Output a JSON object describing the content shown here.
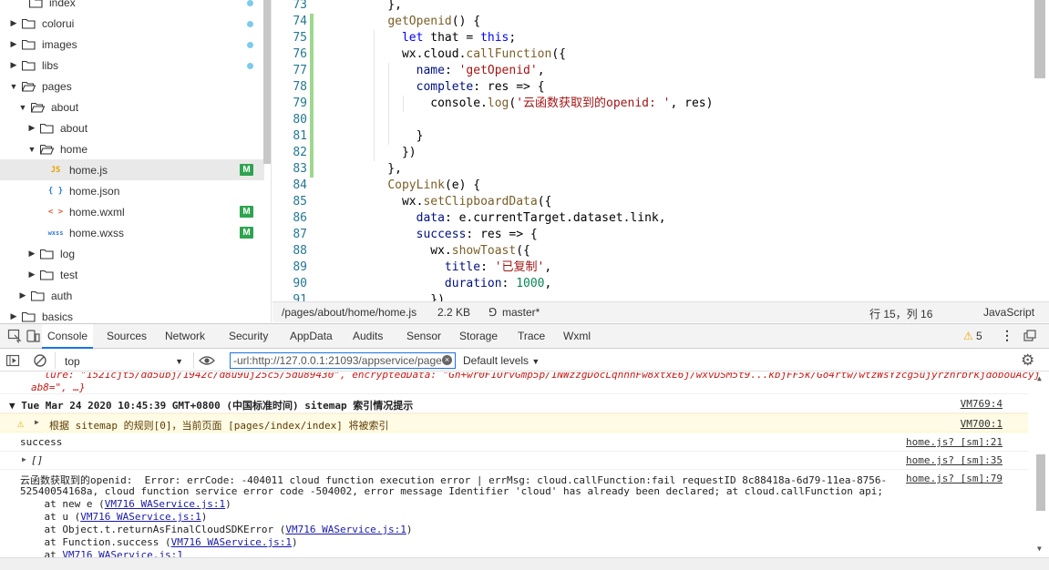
{
  "tree": {
    "items": [
      {
        "label": "index",
        "arrow": "",
        "icon": "folder",
        "dot": true
      },
      {
        "label": "colorui",
        "arrow": "▶",
        "icon": "folder",
        "dot": true
      },
      {
        "label": "images",
        "arrow": "▶",
        "icon": "folder",
        "dot": true
      },
      {
        "label": "libs",
        "arrow": "▶",
        "icon": "folder",
        "dot": true
      },
      {
        "label": "pages",
        "arrow": "▼",
        "icon": "folder-open"
      },
      {
        "label": "about",
        "arrow": "▼",
        "icon": "folder-open"
      },
      {
        "label": "about",
        "arrow": "▶",
        "icon": "folder"
      },
      {
        "label": "home",
        "arrow": "▼",
        "icon": "folder-open"
      },
      {
        "label": "home.js",
        "icon": "JS",
        "badge": "M",
        "selected": true
      },
      {
        "label": "home.json",
        "icon": "{ }"
      },
      {
        "label": "home.wxml",
        "icon": "< >",
        "badge": "M"
      },
      {
        "label": "home.wxss",
        "icon": "wxss",
        "badge": "M"
      },
      {
        "label": "log",
        "arrow": "▶",
        "icon": "folder"
      },
      {
        "label": "test",
        "arrow": "▶",
        "icon": "folder"
      },
      {
        "label": "auth",
        "arrow": "▶",
        "icon": "folder"
      },
      {
        "label": "basics",
        "arrow": "▶",
        "icon": "folder"
      }
    ]
  },
  "editor": {
    "lines": [
      {
        "n": "73",
        "code": "    },"
      },
      {
        "n": "74",
        "code": "    getOpenid() {"
      },
      {
        "n": "75",
        "code": "      let that = this;"
      },
      {
        "n": "76",
        "code": "      wx.cloud.callFunction({"
      },
      {
        "n": "77",
        "code": "        name: 'getOpenid',"
      },
      {
        "n": "78",
        "code": "        complete: res => {"
      },
      {
        "n": "79",
        "code": "          console.log('云函数获取到的openid: ', res)"
      },
      {
        "n": "80",
        "code": ""
      },
      {
        "n": "81",
        "code": "        }"
      },
      {
        "n": "82",
        "code": "      })"
      },
      {
        "n": "83",
        "code": "    },"
      },
      {
        "n": "84",
        "code": "    CopyLink(e) {"
      },
      {
        "n": "85",
        "code": "      wx.setClipboardData({"
      },
      {
        "n": "86",
        "code": "        data: e.currentTarget.dataset.link,"
      },
      {
        "n": "87",
        "code": "        success: res => {"
      },
      {
        "n": "88",
        "code": "          wx.showToast({"
      },
      {
        "n": "89",
        "code": "            title: '已复制',"
      },
      {
        "n": "90",
        "code": "            duration: 1000,"
      },
      {
        "n": "91",
        "code": "          })"
      }
    ]
  },
  "status": {
    "path": "/pages/about/home/home.js",
    "size": "2.2 KB",
    "branch": "master*",
    "position": "行 15，列 16",
    "language": "JavaScript"
  },
  "devtools": {
    "tabs": [
      "Console",
      "Sources",
      "Network",
      "Security",
      "AppData",
      "Audits",
      "Sensor",
      "Storage",
      "Trace",
      "Wxml"
    ],
    "active_tab": "Console",
    "warning_count": "5"
  },
  "console_toolbar": {
    "context": "top",
    "filter_value": "-url:http://127.0.0.1:21093/appservice/page",
    "levels": "Default levels"
  },
  "console": {
    "truncated_line": "    lure: \"1521cjt5/dd5ubj/1942c/d8u9uj25c5/5du89430\", encryptedData: \"Gn+wr0F1OrvGmp5p/1NWzzgDocLqhnhFw8xtxE6j/wxvDSM5t9...kbjFF5k/Go4rtw/wtzWsYzcg5ujyrznrbrkjdobouAcyj",
    "truncated_line2": "ab8=\", …}",
    "group_header": "▼ Tue Mar 24 2020 10:45:39 GMT+0800 (中国标准时间) sitemap 索引情况提示",
    "group_src": "VM769:4",
    "warning_text": "根据 sitemap 的规则[0]，当前页面 [pages/index/index] 将被索引",
    "warning_src": "VM700:1",
    "success_text": "success",
    "success_src": "home.js? [sm]:21",
    "array_text": "[]",
    "array_src": "home.js? [sm]:35",
    "error_line1": "云函数获取到的openid:  Error: errCode: -404011 cloud function execution error | errMsg: cloud.callFunction:fail requestID 8c88418a-6d79-11ea-8756-",
    "error_line2": "52540054168a, cloud function service error code -504002, error message Identifier 'cloud' has already been declared; at cloud.callFunction api;",
    "error_src": "home.js? [sm]:79",
    "stack": [
      {
        "prefix": "    at new e (",
        "link": "VM716 WAService.js:1",
        "suffix": ")"
      },
      {
        "prefix": "    at u (",
        "link": "VM716 WAService.js:1",
        "suffix": ")"
      },
      {
        "prefix": "    at Object.t.returnAsFinalCloudSDKError (",
        "link": "VM716 WAService.js:1",
        "suffix": ")"
      },
      {
        "prefix": "    at Function.success (",
        "link": "VM716 WAService.js:1",
        "suffix": ")"
      },
      {
        "prefix": "    at ",
        "link": "VM716 WAService.js:1",
        "suffix": ""
      }
    ]
  },
  "colors": {
    "accent": "#1a73e8",
    "warning_bg": "#fffbe5",
    "badge_green": "#2ea44f",
    "dot_blue": "#7dcbeb"
  }
}
